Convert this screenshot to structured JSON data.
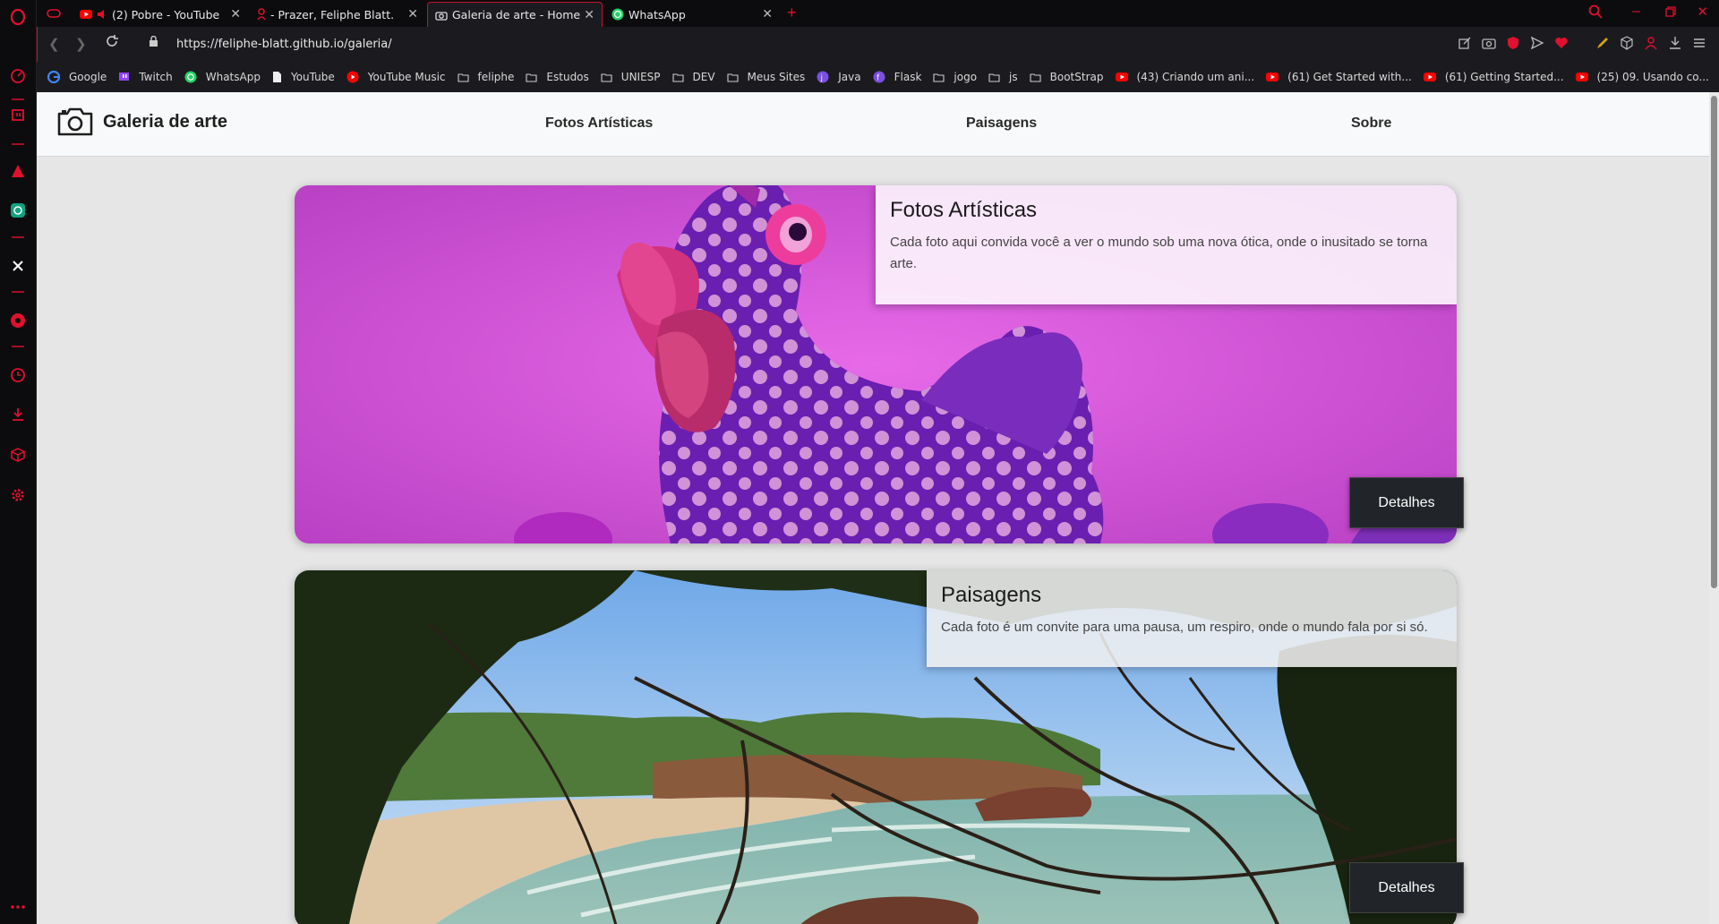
{
  "browser": {
    "tabs": [
      {
        "title": "(2) Pobre - YouTube"
      },
      {
        "title": "- Prazer, Feliphe Blatt."
      },
      {
        "title": "Galeria de arte - Home"
      },
      {
        "title": "WhatsApp"
      }
    ],
    "url": "https://feliphe-blatt.github.io/galeria/",
    "bookmarks": [
      "Google",
      "Twitch",
      "WhatsApp",
      "YouTube",
      "YouTube Music",
      "feliphe",
      "Estudos",
      "UNIESP",
      "DEV",
      "Meus Sites",
      "Java",
      "Flask",
      "jogo",
      "js",
      "BootStrap",
      "(43) Criando um ani...",
      "(61) Get Started with...",
      "(61) Getting Started...",
      "(25) 09. Usando co..."
    ]
  },
  "navbar": {
    "brand": "Galeria de arte",
    "links": [
      "Fotos Artísticas",
      "Paisagens",
      "Sobre"
    ]
  },
  "cards": [
    {
      "title": "Fotos Artísticas",
      "text": "Cada foto aqui convida você a ver o mundo sob uma nova ótica, onde o inusitado se torna arte.",
      "button": "Detalhes"
    },
    {
      "title": "Paisagens",
      "text": "Cada foto é um convite para uma pausa, um respiro, onde o mundo fala por si só.",
      "button": "Detalhes"
    }
  ],
  "colors": {
    "accent": "#c8102e",
    "navbar_bg": "#f8f9fa",
    "button_bg": "#212529"
  },
  "icons": [
    "opera-icon",
    "camera-icon"
  ]
}
